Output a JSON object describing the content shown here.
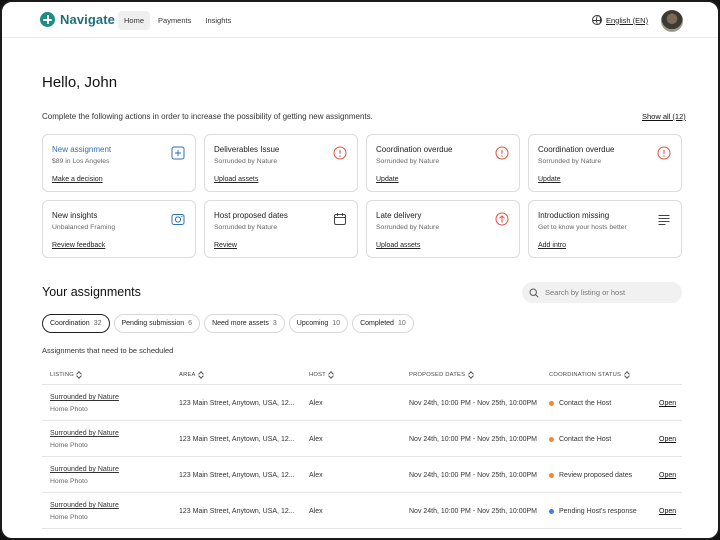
{
  "nav": {
    "logo_text": "Navigate",
    "tabs": [
      {
        "label": "Home",
        "active": true
      },
      {
        "label": "Payments",
        "active": false
      },
      {
        "label": "Insights",
        "active": false
      }
    ],
    "language": "English (EN)"
  },
  "greeting": "Hello, John",
  "intro_text": "Complete the following actions in order to increase the possibility of getting new assignments.",
  "show_all": "Show all (12)",
  "cards": [
    {
      "title": "New assignment",
      "subtitle": "$89 in Los Angeles",
      "action": "Make a decision",
      "icon": "plus-square-icon"
    },
    {
      "title": "Deliverables Issue",
      "subtitle": "Sorrunded by Nature",
      "action": "Upload assets",
      "icon": "alert-circle-icon"
    },
    {
      "title": "Coordination overdue",
      "subtitle": "Sorrunded by Nature",
      "action": "Update",
      "icon": "alert-circle-icon"
    },
    {
      "title": "Coordination overdue",
      "subtitle": "Sorrunded by Nature",
      "action": "Update",
      "icon": "alert-circle-icon"
    },
    {
      "title": "New insights",
      "subtitle": "Unbalanced Framing",
      "action": "Review feedback",
      "icon": "camera-icon"
    },
    {
      "title": "Host proposed dates",
      "subtitle": "Sorrunded by Nature",
      "action": "Review",
      "icon": "calendar-icon"
    },
    {
      "title": "Late delivery",
      "subtitle": "Sorrunded by Nature",
      "action": "Upload assets",
      "icon": "upload-circle-icon"
    },
    {
      "title": "Introduction missing",
      "subtitle": "Get to know your hosts better",
      "action": "Add intro",
      "icon": "text-lines-icon"
    }
  ],
  "assignments": {
    "title": "Your assignments",
    "search_placeholder": "Search by listing or host",
    "chips": [
      {
        "label": "Coordination",
        "count": "32",
        "active": true
      },
      {
        "label": "Pending submission",
        "count": "6",
        "active": false
      },
      {
        "label": "Need more assets",
        "count": "3",
        "active": false
      },
      {
        "label": "Upcoming",
        "count": "10",
        "active": false
      },
      {
        "label": "Completed",
        "count": "10",
        "active": false
      }
    ],
    "subheading": "Assignments that need to be scheduled",
    "columns": [
      "LISTING",
      "AREA",
      "HOST",
      "PROPOSED DATES",
      "COORDINATION STATUS"
    ],
    "rows": [
      {
        "listing": "Surrounded by Nature",
        "type": "Home Photo",
        "area": "123 Main Street, Anytown, USA, 12...",
        "host": "Alex",
        "dates": "Nov 24th, 10:00 PM - Nov 25th, 10:00PM",
        "status": "Contact the Host",
        "status_color": "#f08a24",
        "action": "Open"
      },
      {
        "listing": "Surrounded by Nature",
        "type": "Home Photo",
        "area": "123 Main Street, Anytown, USA, 12...",
        "host": "Alex",
        "dates": "Nov 24th, 10:00 PM - Nov 25th, 10:00PM",
        "status": "Contact the Host",
        "status_color": "#f08a24",
        "action": "Open"
      },
      {
        "listing": "Surrounded by Nature",
        "type": "Home Photo",
        "area": "123 Main Street, Anytown, USA, 12...",
        "host": "Alex",
        "dates": "Nov 24th, 10:00 PM - Nov 25th, 10:00PM",
        "status": "Review proposed dates",
        "status_color": "#f08a24",
        "action": "Open"
      },
      {
        "listing": "Surrounded by Nature",
        "type": "Home Photo",
        "area": "123 Main Street, Anytown, USA, 12...",
        "host": "Alex",
        "dates": "Nov 24th, 10:00 PM - Nov 25th, 10:00PM",
        "status": "Pending Host's response",
        "status_color": "#3d7fd6",
        "action": "Open"
      }
    ]
  },
  "colors": {
    "brand": "#1f8a8a",
    "accent_blue": "#2f6fb4",
    "alert_red": "#e0533d",
    "pending_blue": "#3d7fd6",
    "contact_orange": "#f08a24"
  }
}
